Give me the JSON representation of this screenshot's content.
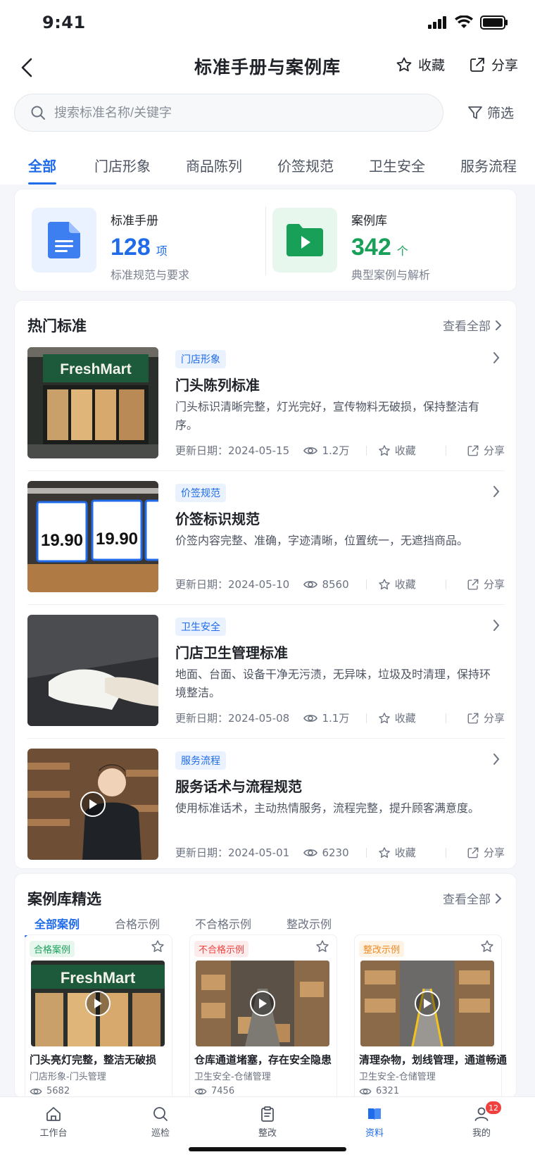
{
  "status_bar": {
    "time": "9:41"
  },
  "header": {
    "title": "标准手册与案例库",
    "favorite_label": "收藏",
    "share_label": "分享"
  },
  "search": {
    "placeholder": "搜索标准名称/关键字",
    "value": "",
    "filter_label": "筛选"
  },
  "tabs": [
    {
      "label": "全部",
      "active": true
    },
    {
      "label": "门店形象"
    },
    {
      "label": "商品陈列"
    },
    {
      "label": "价签规范"
    },
    {
      "label": "卫生安全"
    },
    {
      "label": "服务流程"
    }
  ],
  "summary": {
    "manual": {
      "label": "标准手册",
      "count": "128",
      "unit": "项",
      "desc": "标准规范与要求",
      "color": "#1f6bea"
    },
    "cases": {
      "label": "案例库",
      "count": "342",
      "unit": "个",
      "desc": "典型案例与解析",
      "color": "#18a058"
    }
  },
  "hot": {
    "title": "热门标准",
    "see_all": "查看全部",
    "items": [
      {
        "tag": "门店形象",
        "title": "门头陈列标准",
        "desc": "门头标识清晰完整，灯光完好，宣传物料无破损，保持整洁有序。",
        "date": "更新日期：2024-05-15",
        "views": "1.2万",
        "fav": "收藏",
        "share": "分享",
        "thumb_text": "FreshMart"
      },
      {
        "tag": "价签规范",
        "title": "价签标识规范",
        "desc": "价签内容完整、准确，字迹清晰，位置统一，无遮挡商品。",
        "date": "更新日期：2024-05-10",
        "views": "8560",
        "fav": "收藏",
        "share": "分享",
        "thumb_text": "19.90"
      },
      {
        "tag": "卫生安全",
        "title": "门店卫生管理标准",
        "desc": "地面、台面、设备干净无污渍，无异味，垃圾及时清理，保持环境整洁。",
        "date": "更新日期：2024-05-08",
        "views": "1.1万",
        "fav": "收藏",
        "share": "分享"
      },
      {
        "tag": "服务流程",
        "title": "服务话术与流程规范",
        "desc": "使用标准话术，主动热情服务，流程完整，提升顾客满意度。",
        "date": "更新日期：2024-05-01",
        "views": "6230",
        "fav": "收藏",
        "share": "分享"
      }
    ]
  },
  "case_library": {
    "title": "案例库精选",
    "see_all": "查看全部",
    "tabs": [
      {
        "label": "全部案例",
        "active": true
      },
      {
        "label": "合格示例"
      },
      {
        "label": "不合格示例"
      },
      {
        "label": "整改示例"
      }
    ],
    "cards": [
      {
        "tag": "合格案例",
        "tag_color": "#18a058",
        "tag_bg": "#e8f7ee",
        "title": "门头亮灯完整，整洁无破损",
        "sub": "门店形象-门头管理",
        "views": "5682",
        "thumb_text": "FreshMart"
      },
      {
        "tag": "不合格示例",
        "tag_color": "#f0413e",
        "tag_bg": "#fdecec",
        "title": "仓库通道堵塞，存在安全隐患",
        "sub": "卫生安全-仓储管理",
        "views": "7456"
      },
      {
        "tag": "整改示例",
        "tag_color": "#f08a24",
        "tag_bg": "#fff3e6",
        "title": "清理杂物，划线管理，通道畅通",
        "sub": "卫生安全-仓储管理",
        "views": "6321"
      }
    ]
  },
  "bottom_nav": [
    {
      "label": "工作台",
      "icon": "home-icon"
    },
    {
      "label": "巡检",
      "icon": "search-icon"
    },
    {
      "label": "整改",
      "icon": "clipboard-icon"
    },
    {
      "label": "资料",
      "icon": "book-icon",
      "active": true
    },
    {
      "label": "我的",
      "icon": "user-icon",
      "badge": "12"
    }
  ]
}
